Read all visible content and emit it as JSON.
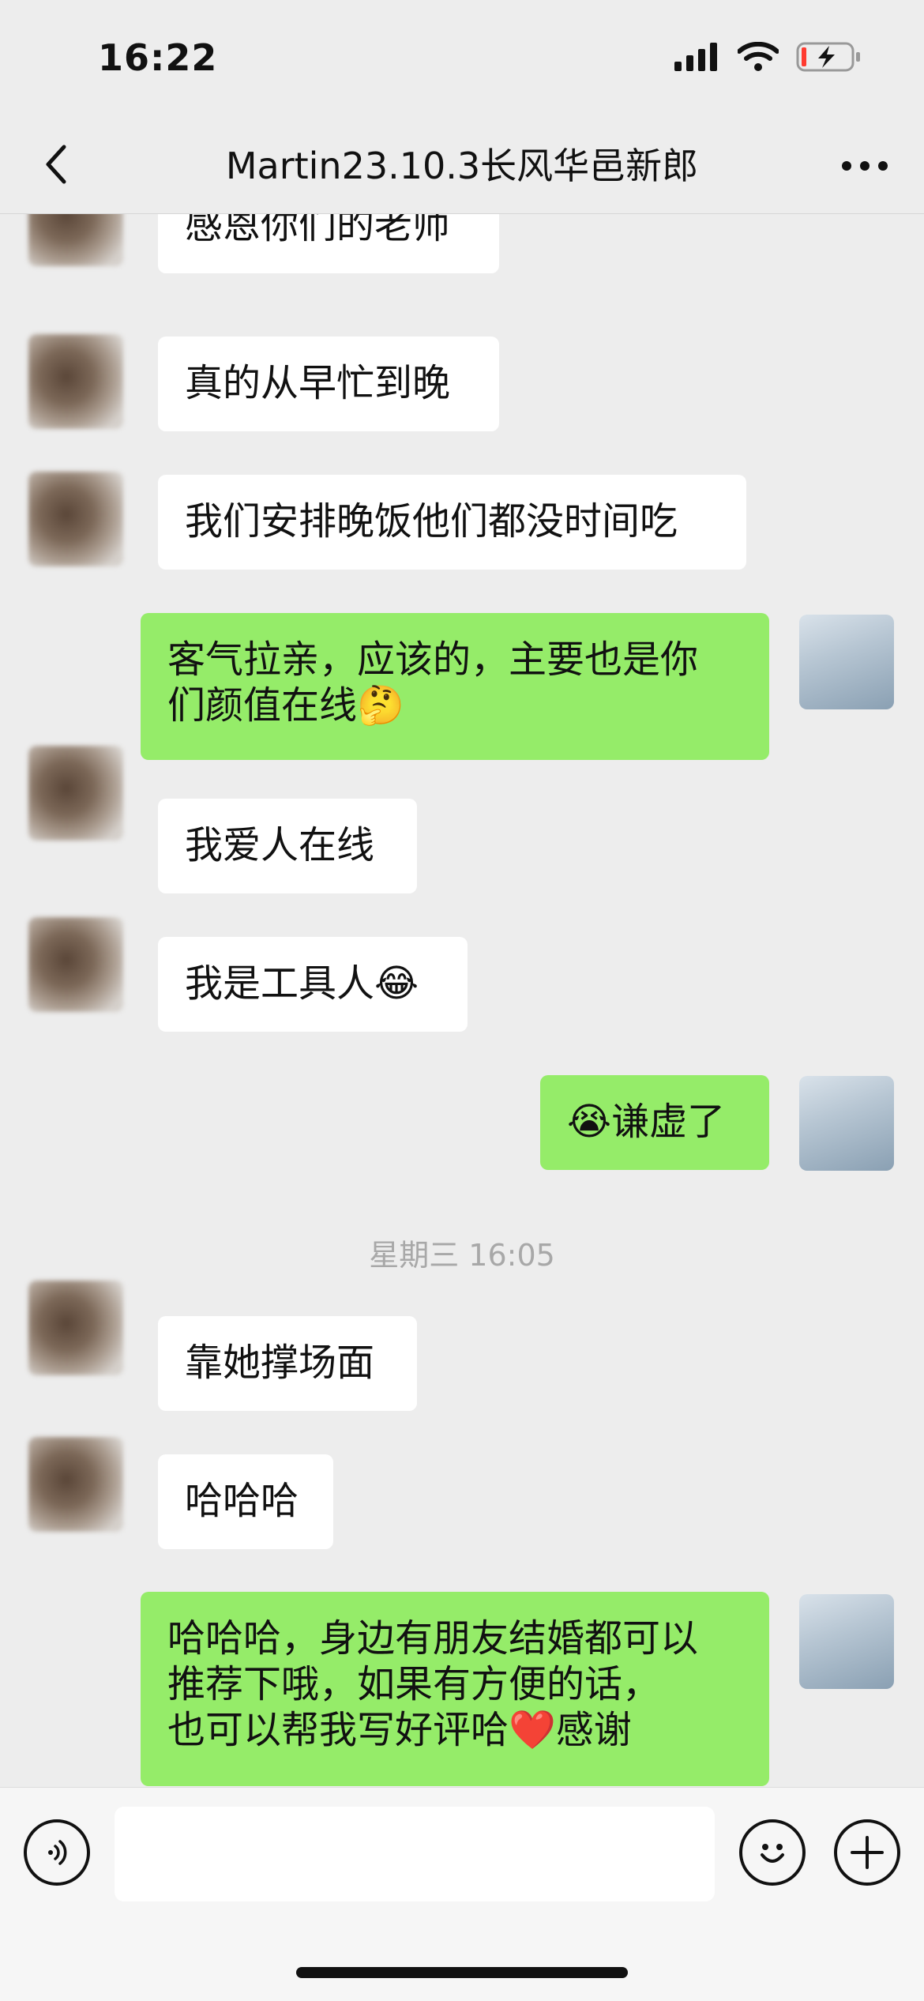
{
  "status_bar": {
    "time": "16:22"
  },
  "header": {
    "title": "Martin23.10.3长风华邑新郎"
  },
  "messages": [
    {
      "side": "in",
      "text": "感恩你们的老师"
    },
    {
      "side": "in",
      "text": "真的从早忙到晚"
    },
    {
      "side": "in",
      "text": "我们安排晚饭他们都没时间吃"
    },
    {
      "side": "out",
      "text": "客气拉亲，应该的，主要也是你\n们颜值在线🤔"
    },
    {
      "side": "in",
      "text": "我爱人在线"
    },
    {
      "side": "in",
      "text": "我是工具人😂"
    },
    {
      "side": "out",
      "text": "😭谦虚了"
    },
    {
      "side": "in",
      "text": "靠她撑场面"
    },
    {
      "side": "in",
      "text": "哈哈哈"
    },
    {
      "side": "out",
      "text": "哈哈哈，身边有朋友结婚都可以\n推荐下哦，如果有方便的话，\n也可以帮我写好评哈❤️感谢"
    }
  ],
  "timestamp": "星期三 16:05",
  "icons": {
    "back": "chevron-left-icon",
    "more": "more-dots-icon",
    "voice": "voice-icon",
    "emoji": "emoji-icon",
    "plus": "plus-icon"
  },
  "colors": {
    "background": "#ededed",
    "outgoing_bubble": "#95ec69",
    "incoming_bubble": "#ffffff"
  }
}
